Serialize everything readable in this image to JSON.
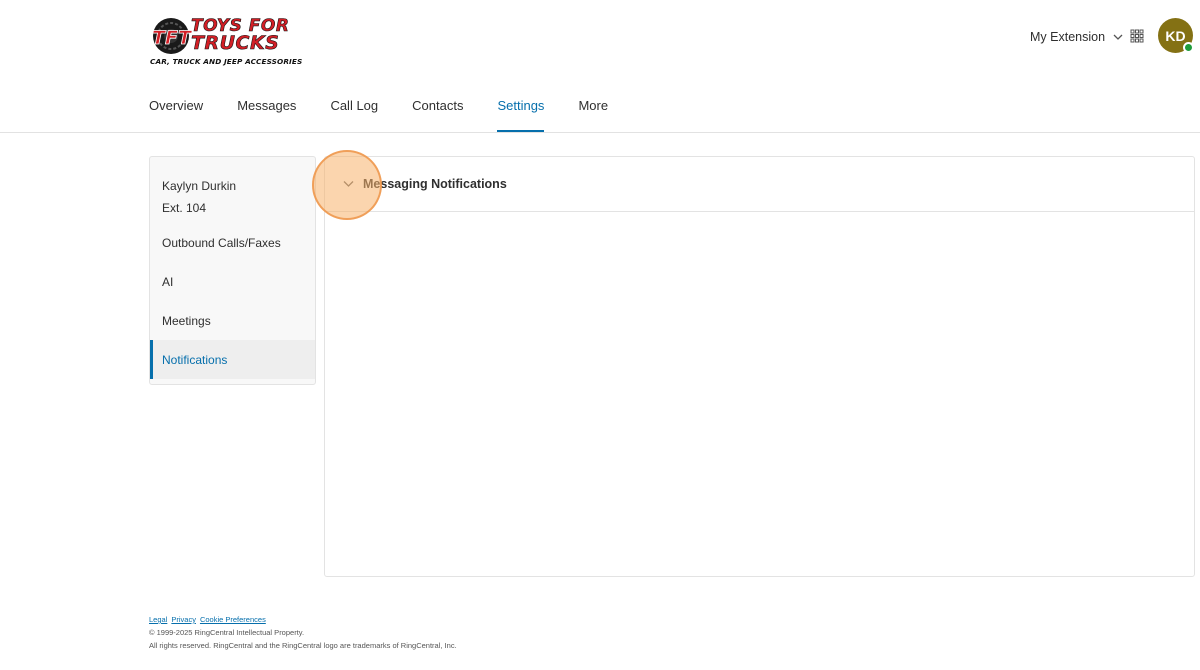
{
  "header": {
    "logo": {
      "brand_line1": "TOYS FOR",
      "brand_line2": "TRUCKS",
      "tagline": "CAR, TRUCK AND JEEP ACCESSORIES",
      "brand_color": "#d21f26"
    },
    "extension_switcher_label": "My Extension",
    "apps_icon": "grid-icon",
    "avatar_initials": "KD",
    "avatar_color": "#847114",
    "presence_color": "#1e9c3c"
  },
  "tabs": [
    {
      "label": "Overview",
      "active": false
    },
    {
      "label": "Messages",
      "active": false
    },
    {
      "label": "Call Log",
      "active": false
    },
    {
      "label": "Contacts",
      "active": false
    },
    {
      "label": "Settings",
      "active": true
    },
    {
      "label": "More",
      "active": false
    }
  ],
  "sidebar": {
    "user_name": "Kaylyn Durkin",
    "user_ext": "Ext. 104",
    "items": [
      {
        "label": "Outbound Calls/Faxes",
        "active": false
      },
      {
        "label": "AI",
        "active": false
      },
      {
        "label": "Meetings",
        "active": false
      },
      {
        "label": "Notifications",
        "active": true
      }
    ]
  },
  "main": {
    "section_title": "Messaging Notifications",
    "section_icon": "chevron-down-icon"
  },
  "footer": {
    "links": [
      "Legal",
      "Privacy",
      "Cookie Preferences"
    ],
    "copyright": "© 1999-2025 RingCentral Intellectual Property.",
    "rights": "All rights reserved. RingCentral and the RingCentral logo are trademarks of RingCentral, Inc."
  },
  "colors": {
    "accent": "#066fac",
    "click_highlight": "#f7b26c"
  }
}
